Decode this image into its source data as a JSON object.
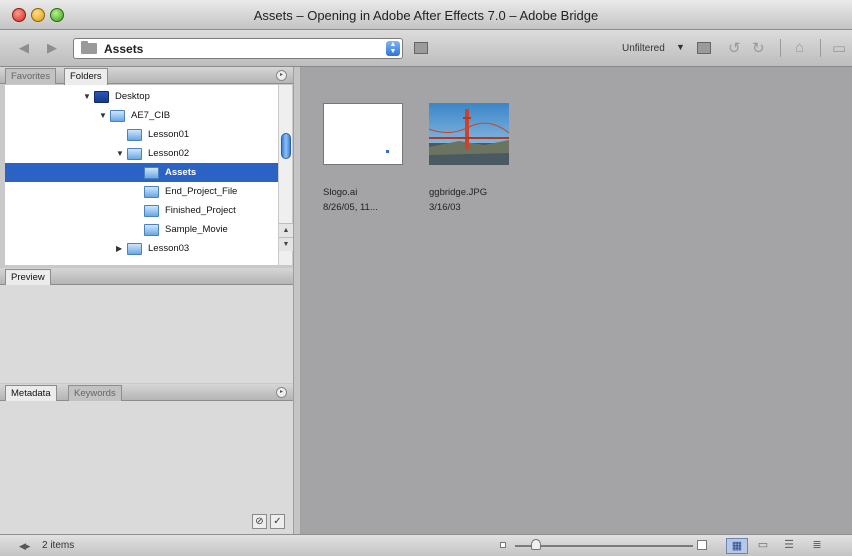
{
  "window": {
    "title": "Assets – Opening in Adobe After Effects 7.0 – Adobe Bridge"
  },
  "toolbar": {
    "back_icon": "back-arrow-icon",
    "forward_icon": "forward-arrow-icon",
    "path_label": "Assets",
    "filter_label": "Unfiltered"
  },
  "panels": {
    "folders_tabs": [
      "Favorites",
      "Folders"
    ],
    "preview_tab": "Preview",
    "metadata_tabs": [
      "Metadata",
      "Keywords"
    ]
  },
  "folder_tree": [
    {
      "label": "Desktop",
      "expanded": true,
      "selected": false
    },
    {
      "label": "AE7_CIB",
      "expanded": true,
      "selected": false
    },
    {
      "label": "Lesson01",
      "expanded": false,
      "selected": false
    },
    {
      "label": "Lesson02",
      "expanded": true,
      "selected": false
    },
    {
      "label": "Assets",
      "expanded": false,
      "selected": true
    },
    {
      "label": "End_Project_File",
      "expanded": false,
      "selected": false
    },
    {
      "label": "Finished_Project",
      "expanded": false,
      "selected": false
    },
    {
      "label": "Sample_Movie",
      "expanded": false,
      "selected": false
    },
    {
      "label": "Lesson03",
      "expanded": false,
      "selected": false
    }
  ],
  "thumbnails": [
    {
      "name": "Slogo.ai",
      "date": "8/26/05, 11..."
    },
    {
      "name": "ggbridge.JPG",
      "date": "3/16/03"
    }
  ],
  "status": {
    "item_count": "2 items"
  },
  "colors": {
    "selection": "#2b63c4",
    "content_bg": "#a4a4a6"
  }
}
